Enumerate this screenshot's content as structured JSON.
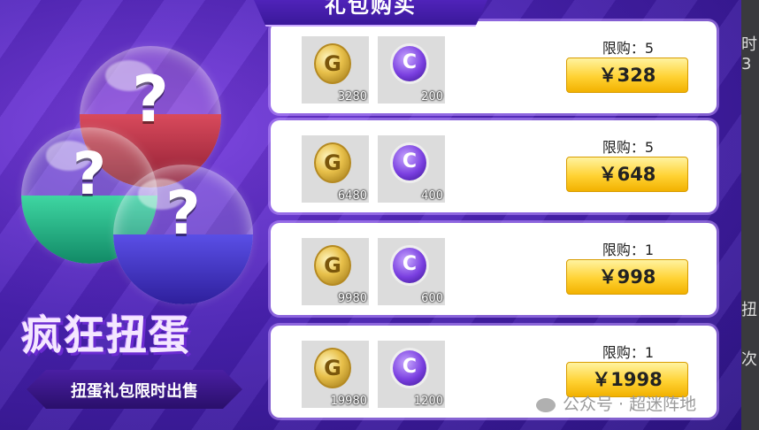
{
  "header": {
    "title": "礼包购买"
  },
  "promo": {
    "title": "疯狂扭蛋",
    "subtitle": "扭蛋礼包限时出售",
    "balls": [
      {
        "color": "#d94a5c",
        "symbol": "?"
      },
      {
        "color": "#3fd6a2",
        "symbol": "?"
      },
      {
        "color": "#5a4fe6",
        "symbol": "?"
      }
    ]
  },
  "items_icons": {
    "gold": "G",
    "ticket": "C"
  },
  "packs": [
    {
      "gold_qty": "3280",
      "ticket_qty": "200",
      "limit": "限购：5",
      "price": "￥328"
    },
    {
      "gold_qty": "6480",
      "ticket_qty": "400",
      "limit": "限购：5",
      "price": "￥648"
    },
    {
      "gold_qty": "9980",
      "ticket_qty": "600",
      "limit": "限购：1",
      "price": "￥998"
    },
    {
      "gold_qty": "19980",
      "ticket_qty": "1200",
      "limit": "限购：1",
      "price": "￥1998"
    }
  ],
  "side_chars": [
    "时3",
    "扭",
    "次"
  ],
  "watermark": "公众号 · 超迷阵地",
  "colors": {
    "accent_purple": "#5f2bd0",
    "button_gold": "#ffd233"
  }
}
